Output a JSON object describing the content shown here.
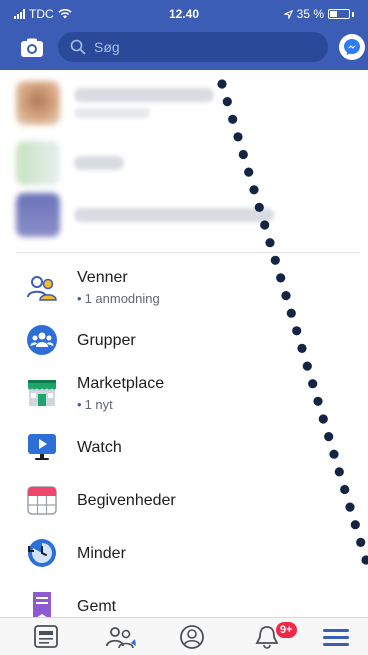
{
  "status_bar": {
    "carrier": "TDC",
    "time": "12.40",
    "battery": "35 %"
  },
  "header": {
    "search_placeholder": "Søg",
    "camera_icon": "camera-icon",
    "messenger_icon": "messenger-icon"
  },
  "menu": {
    "items": [
      {
        "label": "Venner",
        "sub": "1 anmodning",
        "icon": "friends-icon"
      },
      {
        "label": "Grupper",
        "sub": "",
        "icon": "groups-icon"
      },
      {
        "label": "Marketplace",
        "sub": "1 nyt",
        "icon": "marketplace-icon"
      },
      {
        "label": "Watch",
        "sub": "",
        "icon": "watch-icon"
      },
      {
        "label": "Begivenheder",
        "sub": "",
        "icon": "events-icon"
      },
      {
        "label": "Minder",
        "sub": "",
        "icon": "memories-icon"
      },
      {
        "label": "Gemt",
        "sub": "",
        "icon": "saved-icon"
      }
    ]
  },
  "tabbar": {
    "notifications_badge": "9+"
  },
  "colors": {
    "brand_blue": "#3b5db5",
    "badge_red": "#f02849",
    "dots": "#142544"
  }
}
